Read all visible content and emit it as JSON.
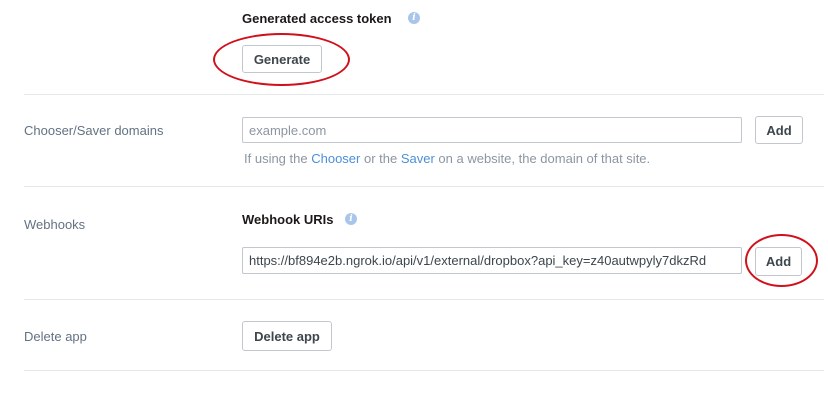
{
  "access_token": {
    "heading": "Generated access token",
    "info_icon": "info-icon",
    "generate_label": "Generate"
  },
  "chooser": {
    "label": "Chooser/Saver domains",
    "input_placeholder": "example.com",
    "add_label": "Add",
    "hint_prefix": "If using the ",
    "hint_link_chooser": "Chooser",
    "hint_middle": " or the ",
    "hint_link_saver": "Saver",
    "hint_suffix": " on a website, the domain of that site."
  },
  "webhooks": {
    "label": "Webhooks",
    "heading": "Webhook URIs",
    "info_icon": "info-icon",
    "uri_value": "https://bf894e2b.ngrok.io/api/v1/external/dropbox?api_key=z40autwpyly7dkzRd",
    "add_label": "Add"
  },
  "delete_app": {
    "label": "Delete app",
    "button_label": "Delete app"
  },
  "colors": {
    "annotation_ring": "#d0101a",
    "link": "#4a90d9"
  }
}
